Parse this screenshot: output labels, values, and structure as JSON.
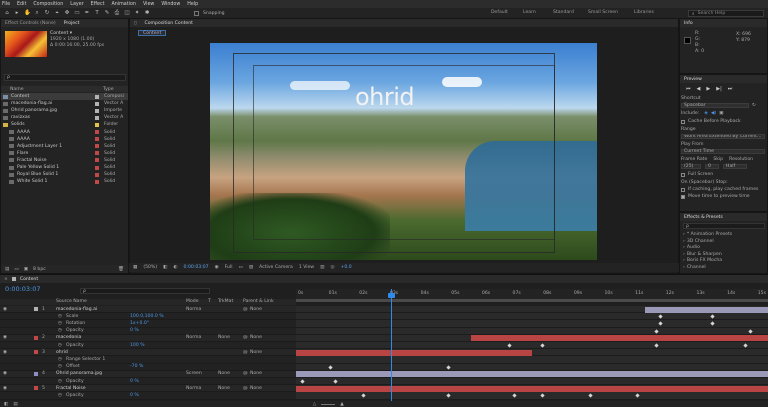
{
  "menu": [
    "File",
    "Edit",
    "Composition",
    "Layer",
    "Effect",
    "Animation",
    "View",
    "Window",
    "Help"
  ],
  "toolbar": {
    "snapping": "Snapping",
    "workspaces": [
      "Default",
      "Learn",
      "Standard",
      "Small Screen",
      "Libraries"
    ],
    "search_placeholder": "Search Help"
  },
  "project": {
    "tabs": [
      "Effect Controls (None)",
      "Project"
    ],
    "item_name": "Content ▾",
    "item_size": "1920 x 1080 (1.00)",
    "item_duration": "Δ 0:00:16:00, 25.00 fps",
    "search_hint": "ρ",
    "columns": [
      "Name",
      "Type"
    ],
    "items": [
      {
        "name": "Content",
        "type": "Composi",
        "color": "#b3b3b3",
        "icon": "comp"
      },
      {
        "name": "macedonia-flag.ai",
        "type": "Vector A",
        "color": "#b3b3b3",
        "icon": "file"
      },
      {
        "name": "Ohrid panorama.jpg",
        "type": "Importe",
        "color": "#b3b3b3",
        "icon": "file"
      },
      {
        "name": "ravizxas",
        "type": "Vector A",
        "color": "#b3b3b3",
        "icon": "file"
      },
      {
        "name": "Solids",
        "type": "Folder",
        "color": "#e0c44a",
        "icon": "folder"
      },
      {
        "name": "AAAA",
        "type": "Solid",
        "color": "#c04848",
        "icon": "solid"
      },
      {
        "name": "AAAA",
        "type": "Solid",
        "color": "#c04848",
        "icon": "solid"
      },
      {
        "name": "Adjustment Layer 1",
        "type": "Solid",
        "color": "#c04848",
        "icon": "solid"
      },
      {
        "name": "Flare",
        "type": "Solid",
        "color": "#c04848",
        "icon": "solid"
      },
      {
        "name": "Fractal Noise",
        "type": "Solid",
        "color": "#c04848",
        "icon": "solid"
      },
      {
        "name": "Pale Yellow Solid 1",
        "type": "Solid",
        "color": "#c04848",
        "icon": "solid"
      },
      {
        "name": "Royal Blue Solid 1",
        "type": "Solid",
        "color": "#c04848",
        "icon": "solid"
      },
      {
        "name": "White Solid 1",
        "type": "Solid",
        "color": "#c04848",
        "icon": "solid"
      }
    ],
    "footer": "8 bpc"
  },
  "composition": {
    "tab": "Composition Content",
    "subtab": "Content",
    "overlay_title": "ohrid",
    "zoom": "(50%)",
    "timecode": "0:00:03:07",
    "resolution": "Full",
    "camera": "Active Camera",
    "view": "1 View",
    "offset": "+0.0"
  },
  "info": {
    "tab": "Info",
    "r": "R:",
    "g": "G:",
    "b": "B:",
    "a": "A: 0",
    "x": "X: 696",
    "y": "Y: 879"
  },
  "preview": {
    "tab": "Preview",
    "shortcut_label": "Shortcut",
    "shortcut_value": "Spacebar",
    "include_label": "Include:",
    "cache_label": "Cache Before Playback",
    "range_label": "Range",
    "range_value": "Work Area Extended By Current...",
    "play_from_label": "Play From",
    "play_from_value": "Current Time",
    "frame_rate_label": "Frame Rate",
    "skip_label": "Skip",
    "resolution_label": "Resolution",
    "frame_rate_value": "(25)",
    "skip_value": "0",
    "resolution_value": "Half",
    "fullscreen_label": "Full Screen",
    "stop_label": "On (Spacebar) Stop:",
    "if_caching": "If caching, play cached frames",
    "move_time": "Move time to preview time"
  },
  "effects": {
    "tab": "Effects & Presets",
    "search_hint": "ρ",
    "items": [
      "* Animation Presets",
      "3D Channel",
      "Audio",
      "Blur & Sharpen",
      "Boris FX Mocha",
      "Channel"
    ]
  },
  "timeline": {
    "tab": "Content",
    "timecode": "0:00:03:07",
    "search_hint": "ρ",
    "columns": {
      "name": "Source Name",
      "mode": "Mode",
      "t": "T",
      "trkmat": "TrkMat",
      "parent": "Parent & Link"
    },
    "ruler": [
      "0s",
      "01s",
      "02s",
      "03s",
      "04s",
      "05s",
      "06s",
      "07s",
      "08s",
      "09s",
      "10s",
      "11s",
      "12s",
      "13s",
      "14s",
      "15s"
    ],
    "rows": [
      {
        "num": "1",
        "name": "macedonia-flag.ai",
        "mode": "Norma",
        "trk": "",
        "parent": "None",
        "color": "#b3b3b3",
        "layer": true
      },
      {
        "num": "",
        "name": "Scale",
        "value": "100.0,100.0 %",
        "prop": true
      },
      {
        "num": "",
        "name": "Rotation",
        "value": "1x+0.0°",
        "prop": true
      },
      {
        "num": "",
        "name": "Opacity",
        "value": "0 %",
        "prop": true
      },
      {
        "num": "2",
        "name": "macedonia",
        "mode": "Norma",
        "trk": "None",
        "parent": "None",
        "color": "#c04848",
        "layer": true
      },
      {
        "num": "",
        "name": "Opacity",
        "value": "100 %",
        "prop": true
      },
      {
        "num": "3",
        "name": "ohrid",
        "mode": "",
        "trk": "",
        "parent": "None",
        "color": "#c04848",
        "layer": true
      },
      {
        "num": "",
        "name": "Range Selector 1",
        "value": "",
        "prop": true
      },
      {
        "num": "",
        "name": "Offset",
        "value": "-70 %",
        "prop": true
      },
      {
        "num": "4",
        "name": "Ohrid panorama.jpg",
        "mode": "Screen",
        "trk": "None",
        "parent": "None",
        "color": "#8a8fc4",
        "layer": true
      },
      {
        "num": "",
        "name": "Opacity",
        "value": "0 %",
        "prop": true
      },
      {
        "num": "5",
        "name": "Fractal Noise",
        "mode": "Norma",
        "trk": "None",
        "parent": "None",
        "color": "#c04848",
        "layer": true
      },
      {
        "num": "",
        "name": "Opacity",
        "value": "0 %",
        "prop": true
      }
    ]
  },
  "colors": {
    "accent": "#2d8ceb",
    "layer_red": "#b84444",
    "layer_lav": "#9a9ab8",
    "work_area": "#6a6a6a"
  }
}
